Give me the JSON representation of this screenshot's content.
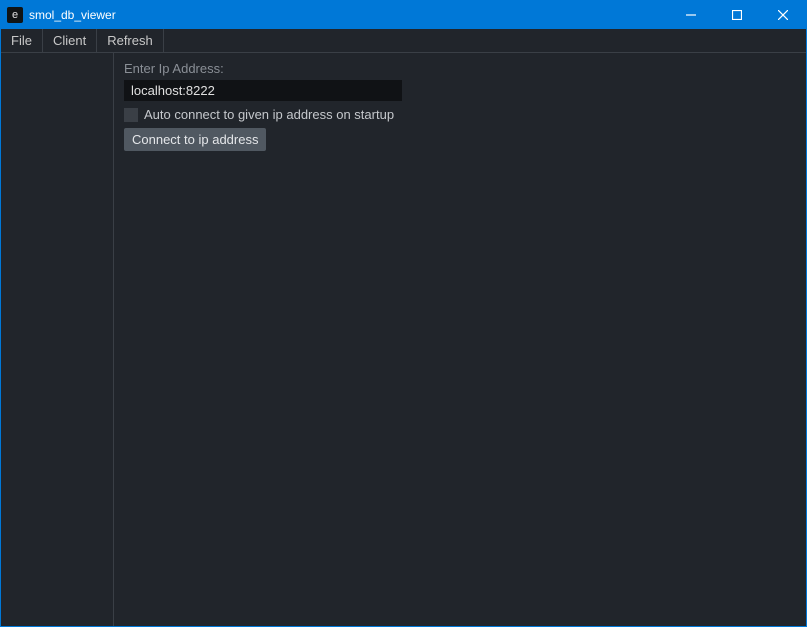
{
  "window": {
    "title": "smol_db_viewer",
    "icon_letter": "e"
  },
  "menu": {
    "items": [
      {
        "label": "File"
      },
      {
        "label": "Client"
      },
      {
        "label": "Refresh"
      }
    ]
  },
  "content": {
    "ip_label": "Enter Ip Address:",
    "ip_value": "localhost:8222",
    "auto_connect_label": "Auto connect to given ip address on startup",
    "connect_button_label": "Connect to ip address"
  }
}
